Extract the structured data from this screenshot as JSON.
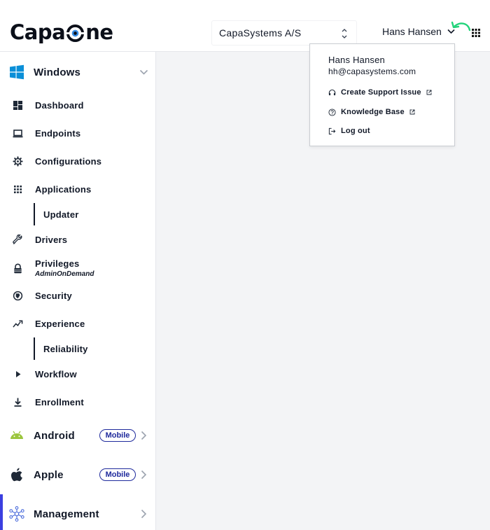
{
  "header": {
    "logo_text_left": "Capa",
    "logo_text_right": "ne",
    "tenant": "CapaSystems A/S",
    "user_name": "Hans Hansen"
  },
  "user_menu": {
    "name": "Hans Hansen",
    "email": "hh@capasystems.com",
    "items": [
      {
        "label": "Create Support Issue",
        "icon": "headset-icon",
        "external": true
      },
      {
        "label": "Knowledge Base",
        "icon": "question-circle-icon",
        "external": true
      },
      {
        "label": "Log out",
        "icon": "logout-icon",
        "external": false
      }
    ]
  },
  "sidebar": {
    "windows": {
      "label": "Windows",
      "items": [
        {
          "label": "Dashboard",
          "icon": "dashboard-icon"
        },
        {
          "label": "Endpoints",
          "icon": "laptop-icon"
        },
        {
          "label": "Configurations",
          "icon": "gear-icon"
        },
        {
          "label": "Applications",
          "icon": "apps-grid-icon"
        },
        {
          "label": "Updater",
          "sub": true
        },
        {
          "label": "Drivers",
          "icon": "wrench-icon"
        },
        {
          "label": "Privileges",
          "sublabel": "AdminOnDemand",
          "icon": "lock-icon"
        },
        {
          "label": "Security",
          "icon": "security-icon"
        },
        {
          "label": "Experience",
          "icon": "trend-icon"
        },
        {
          "label": "Reliability",
          "sub": true
        },
        {
          "label": "Workflow",
          "icon": "play-icon"
        },
        {
          "label": "Enrollment",
          "icon": "download-icon"
        }
      ]
    },
    "android": {
      "label": "Android",
      "badge": "Mobile"
    },
    "apple": {
      "label": "Apple",
      "badge": "Mobile"
    },
    "management": {
      "label": "Management"
    }
  },
  "colors": {
    "accent": "#3b3fe0",
    "badge": "#1f2a9c",
    "windows_blue": "#0a8fd8",
    "android_green": "#9bc53d",
    "management_blue": "#4b6cdb",
    "arrow_green": "#22d37a"
  }
}
